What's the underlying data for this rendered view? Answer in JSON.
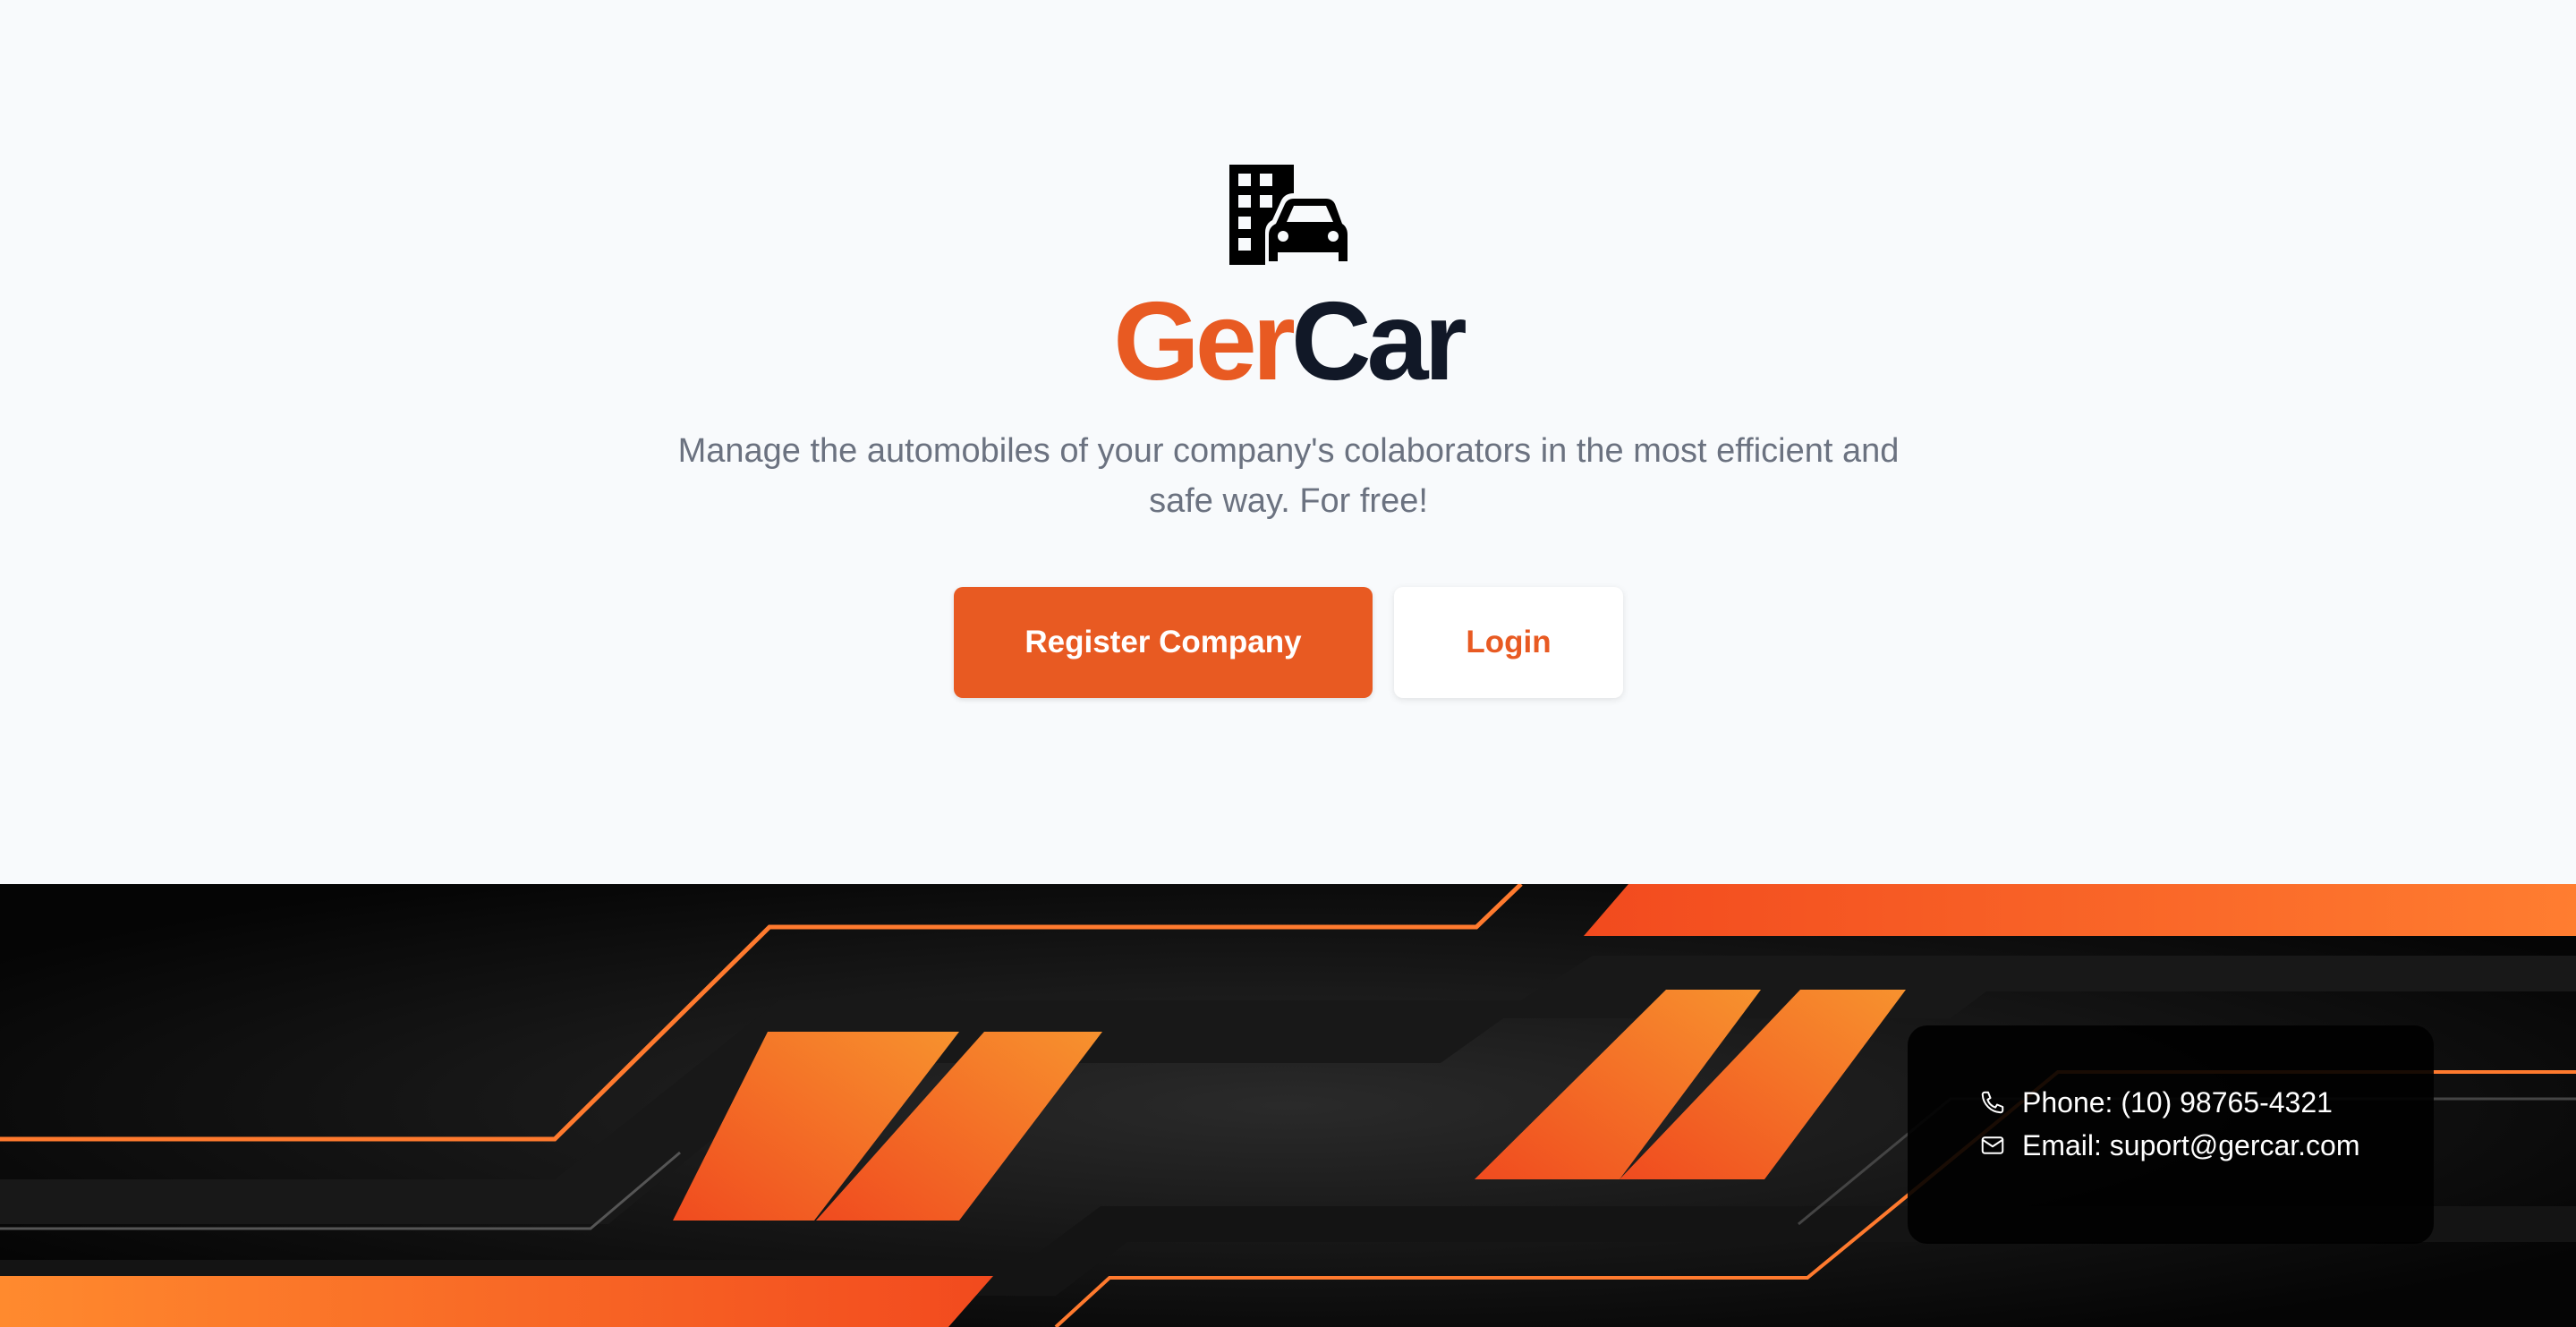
{
  "brand": {
    "name_part1": "Ger",
    "name_part2": "Car",
    "logo_icon": "building-car-icon"
  },
  "hero": {
    "tagline": "Manage the automobiles of your company's colaborators in the most efficient and safe way. For free!"
  },
  "actions": {
    "register_label": "Register Company",
    "login_label": "Login"
  },
  "footer": {
    "phone_icon": "phone-icon",
    "phone_text": "Phone: (10) 98765-4321",
    "email_icon": "mail-icon",
    "email_text": "Email: suport@gercar.com"
  },
  "colors": {
    "accent": "#e85a22",
    "dark_text": "#111827",
    "muted_text": "#6b7280",
    "page_bg": "#f8fafc",
    "footer_bg": "#050505"
  }
}
